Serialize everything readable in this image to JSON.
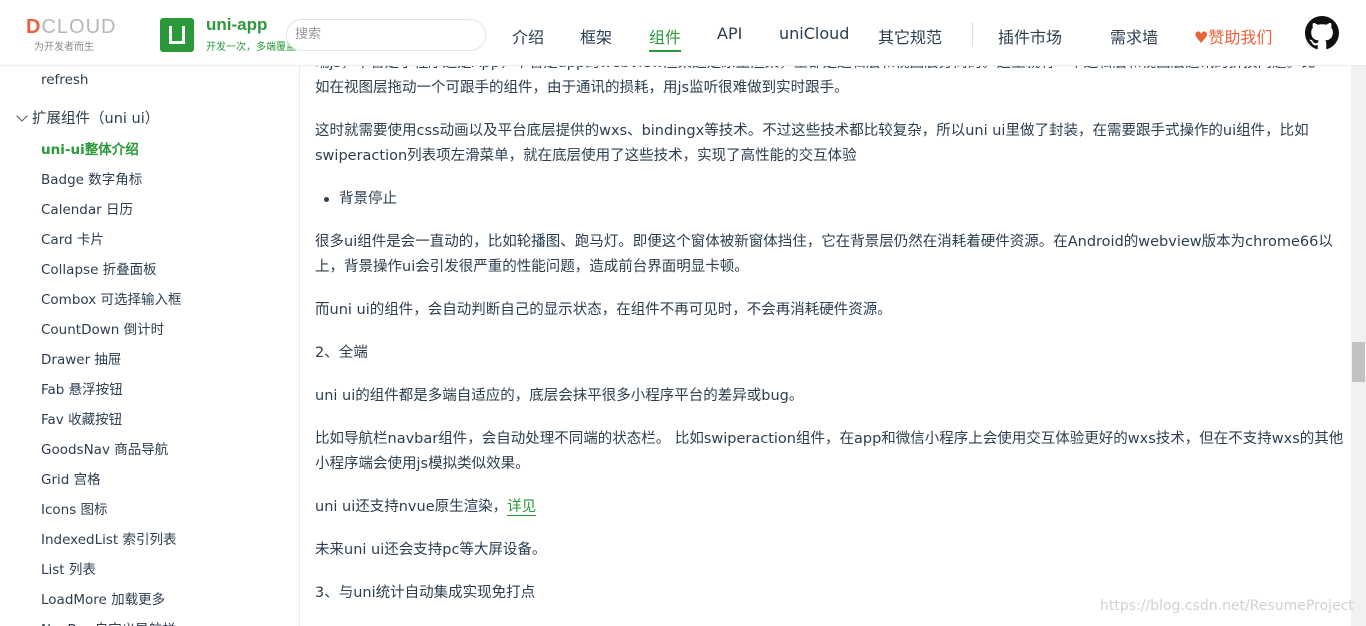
{
  "header": {
    "dcloud_logo": {
      "word_prefix": "D",
      "word_rest": "CLOUD",
      "tagline": "为开发者而生"
    },
    "uniapp_logo": {
      "title": "uni-app",
      "tagline": "开发一次，多端覆盖"
    },
    "search_placeholder": "搜索",
    "nav": [
      {
        "label": "介绍"
      },
      {
        "label": "框架"
      },
      {
        "label": "组件",
        "active": true
      },
      {
        "label": "API"
      },
      {
        "label": "uniCloud"
      },
      {
        "label": "其它规范"
      },
      {
        "label": "插件市场"
      },
      {
        "label": "需求墙"
      },
      {
        "label": "赞助我们",
        "icon": "heart-icon"
      }
    ],
    "github_icon": "github-icon"
  },
  "sidebar": {
    "items_top": [
      "refresh"
    ],
    "group": "扩展组件（uni ui）",
    "items": [
      "uni-ui整体介绍",
      "Badge 数字角标",
      "Calendar 日历",
      "Card 卡片",
      "Collapse 折叠面板",
      "Combox 可选择输入框",
      "CountDown 倒计时",
      "Drawer 抽屉",
      "Fab 悬浮按钮",
      "Fav 收藏按钮",
      "GoodsNav 商品导航",
      "Grid 宫格",
      "Icons 图标",
      "IndexedList 索引列表",
      "List 列表",
      "LoadMore 加载更多",
      "NavBar 自定义导航栏"
    ],
    "active_index": 0
  },
  "content": {
    "para1_line1": "端js，不管是小程序还是App，不管是app的webview渲染还是原生渲染，全都是逻辑层和视图层分离的。这里就有一个逻辑层和视图层通讯的折损问题。比",
    "para1_line2": "如在视图层拖动一个可跟手的组件，由于通讯的损耗，用js监听很难做到实时跟手。",
    "para2_line1": "这时就需要使用css动画以及平台底层提供的wxs、bindingx等技术。不过这些技术都比较复杂，所以uni ui里做了封装，在需要跟手式操作的ui组件，比如",
    "para2_line2": "swiperaction列表项左滑菜单，就在底层使用了这些技术，实现了高性能的交互体验",
    "bullet": "背景停止",
    "para3_line1": "很多ui组件是会一直动的，比如轮播图、跑马灯。即便这个窗体被新窗体挡住，它在背景层仍然在消耗着硬件资源。在Android的webview版本为chrome66以",
    "para3_line2": "上，背景操作ui会引发很严重的性能问题，造成前台界面明显卡顿。",
    "para4": "而uni ui的组件，会自动判断自己的显示状态，在组件不再可见时，不会再消耗硬件资源。",
    "heading2": "2、全端",
    "para5": "uni ui的组件都是多端自适应的，底层会抹平很多小程序平台的差异或bug。",
    "para6_line1": "比如导航栏navbar组件，会自动处理不同端的状态栏。 比如swiperaction组件，在app和微信小程序上会使用交互体验更好的wxs技术，但在不支持wxs的其他",
    "para6_line2": "小程序端会使用js模拟类似效果。",
    "para7_text": "uni ui还支持nvue原生渲染，",
    "para7_link": "详见",
    "para8": "未来uni ui还会支持pc等大屏设备。",
    "heading3": "3、与uni统计自动集成实现免打点"
  },
  "watermark": "https://blog.csdn.net/ResumeProject"
}
